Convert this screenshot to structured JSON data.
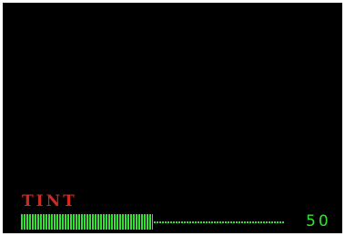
{
  "osd": {
    "label": "TINT",
    "value": "50",
    "level_fraction": 0.5,
    "colors": {
      "background": "#000000",
      "label": "#cc2a22",
      "bar": "#35e035",
      "value": "#35e035"
    }
  }
}
